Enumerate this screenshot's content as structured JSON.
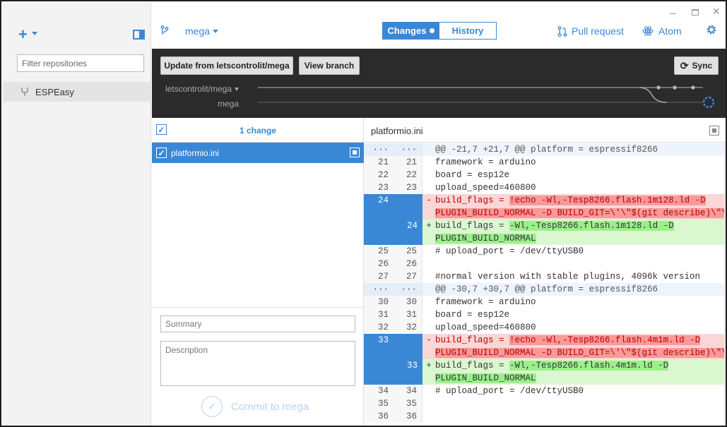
{
  "sidebar": {
    "add_label": "+",
    "filter_placeholder": "Filter repositories",
    "repos": [
      {
        "label": "ESPEasy"
      }
    ]
  },
  "header": {
    "branch": "mega",
    "tab_changes": "Changes",
    "tab_history": "History",
    "pull_request": "Pull request",
    "atom": "Atom"
  },
  "toolbar": {
    "update_label": "Update from letscontrolit/mega",
    "view_branch_label": "View branch",
    "sync_label": "Sync",
    "remote_branch": "letscontrolit/mega",
    "local_branch": "mega"
  },
  "files": {
    "count_label": "1 change",
    "items": [
      {
        "name": "platformio.ini"
      }
    ]
  },
  "commit": {
    "summary_placeholder": "Summary",
    "description_placeholder": "Description",
    "button_label": "Commit to mega"
  },
  "diff": {
    "filename": "platformio.ini",
    "lines": [
      {
        "kind": "hunk",
        "old": "···",
        "new": "···",
        "mark": "",
        "text": "@@ -21,7 +21,7 @@ platform = espressif8266"
      },
      {
        "kind": "ctx",
        "old": "21",
        "new": "21",
        "mark": "",
        "text": "framework = arduino"
      },
      {
        "kind": "ctx",
        "old": "22",
        "new": "22",
        "mark": "",
        "text": "board = esp12e"
      },
      {
        "kind": "ctx",
        "old": "23",
        "new": "23",
        "mark": "",
        "text": "upload_speed=460800"
      },
      {
        "kind": "del",
        "old": "24",
        "new": "",
        "mark": "-",
        "pre": "build_flags = ",
        "hl": "!echo -Wl,-Tesp8266.flash.1m128.ld -D"
      },
      {
        "kind": "del",
        "old": "",
        "new": "",
        "mark": "",
        "pre": "",
        "hl": "PLUGIN_BUILD_NORMAL -D BUILD_GIT=\\'\\\"$(git describe)\\\"\\'"
      },
      {
        "kind": "add",
        "old": "",
        "new": "24",
        "mark": "+",
        "pre": "build_flags = ",
        "hl": "-Wl,-Tesp8266.flash.1m128.ld -D"
      },
      {
        "kind": "add",
        "old": "",
        "new": "",
        "mark": "",
        "pre": "",
        "hl": "PLUGIN_BUILD_NORMAL"
      },
      {
        "kind": "ctx",
        "old": "25",
        "new": "25",
        "mark": "",
        "text": "# upload_port = /dev/ttyUSB0"
      },
      {
        "kind": "ctx",
        "old": "26",
        "new": "26",
        "mark": "",
        "text": ""
      },
      {
        "kind": "ctx",
        "old": "27",
        "new": "27",
        "mark": "",
        "text": "#normal version with stable plugins, 4096k version"
      },
      {
        "kind": "hunk",
        "old": "···",
        "new": "···",
        "mark": "",
        "text": "@@ -30,7 +30,7 @@ platform = espressif8266"
      },
      {
        "kind": "ctx",
        "old": "30",
        "new": "30",
        "mark": "",
        "text": "framework = arduino"
      },
      {
        "kind": "ctx",
        "old": "31",
        "new": "31",
        "mark": "",
        "text": "board = esp12e"
      },
      {
        "kind": "ctx",
        "old": "32",
        "new": "32",
        "mark": "",
        "text": "upload_speed=460800"
      },
      {
        "kind": "del",
        "old": "33",
        "new": "",
        "mark": "-",
        "pre": "build_flags = ",
        "hl": "!echo -Wl,-Tesp8266.flash.4m1m.ld -D"
      },
      {
        "kind": "del",
        "old": "",
        "new": "",
        "mark": "",
        "pre": "",
        "hl": "PLUGIN_BUILD_NORMAL -D BUILD_GIT=\\'\\\"$(git describe)\\\"\\'"
      },
      {
        "kind": "add",
        "old": "",
        "new": "33",
        "mark": "+",
        "pre": "build_flags = ",
        "hl": "-Wl,-Tesp8266.flash.4m1m.ld -D"
      },
      {
        "kind": "add",
        "old": "",
        "new": "",
        "mark": "",
        "pre": "",
        "hl": "PLUGIN_BUILD_NORMAL"
      },
      {
        "kind": "ctx",
        "old": "34",
        "new": "34",
        "mark": "",
        "text": "# upload_port = /dev/ttyUSB0"
      },
      {
        "kind": "ctx",
        "old": "35",
        "new": "35",
        "mark": "",
        "text": ""
      },
      {
        "kind": "ctx",
        "old": "36",
        "new": "36",
        "mark": "",
        "text": ""
      }
    ]
  },
  "colors": {
    "accent": "#3a87d6",
    "dark_bar": "#2b2b2b",
    "deleted_bg": "#fbd6d6",
    "added_bg": "#dbf7d0"
  }
}
